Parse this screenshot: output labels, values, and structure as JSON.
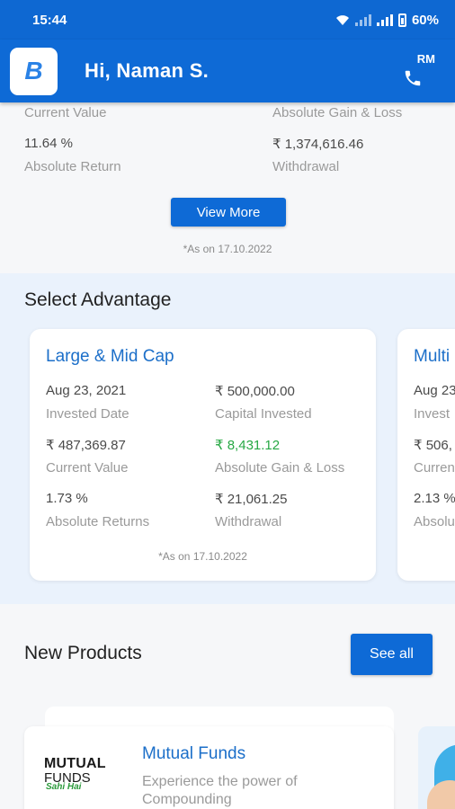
{
  "status_bar": {
    "time": "15:44",
    "battery": "60%"
  },
  "header": {
    "logo_letter": "B",
    "greeting": "Hi, Naman S.",
    "rm_label": "RM"
  },
  "summary": {
    "row1": {
      "left_label": "Current Value",
      "right_label": "Absolute Gain & Loss"
    },
    "row2": {
      "left_value": "11.64 %",
      "left_label": "Absolute Return",
      "right_value": "₹ 1,374,616.46",
      "right_label": "Withdrawal"
    },
    "view_more": "View More",
    "as_on": "*As on 17.10.2022"
  },
  "advantage": {
    "title": "Select Advantage",
    "cards": [
      {
        "title": "Large & Mid Cap",
        "invested_date": "Aug 23, 2021",
        "invested_date_label": "Invested Date",
        "capital_invested": "₹ 500,000.00",
        "capital_invested_label": "Capital Invested",
        "current_value": "₹ 487,369.87",
        "current_value_label": "Current Value",
        "gain_loss": "₹ 8,431.12",
        "gain_loss_label": "Absolute Gain & Loss",
        "absolute_returns": "1.73 %",
        "absolute_returns_label": "Absolute Returns",
        "withdrawal": "₹ 21,061.25",
        "withdrawal_label": "Withdrawal",
        "as_on": "*As on 17.10.2022"
      },
      {
        "title": "Multi",
        "invested_date": "Aug 23",
        "invested_date_label": "Invest",
        "current_value": "₹ 506,",
        "current_value_label": "Curren",
        "absolute_returns": "2.13 %",
        "absolute_returns_label": "Absolu"
      }
    ]
  },
  "products": {
    "title": "New Products",
    "see_all": "See all",
    "items": [
      {
        "logo_line1": "MUTUAL",
        "logo_line2": "FUNDS",
        "logo_line3": "Sahi Hai",
        "title": "Mutual Funds",
        "description": "Experience the power of Compounding"
      }
    ]
  },
  "colors": {
    "primary": "#0e6ad6",
    "accent_text": "#1c6fc9",
    "gain_green": "#27a844"
  }
}
